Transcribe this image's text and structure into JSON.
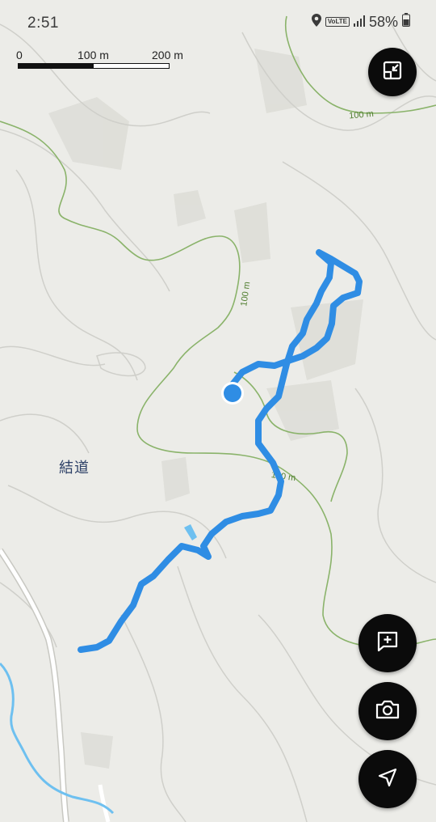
{
  "status_bar": {
    "time": "2:51",
    "network_badge": "VoLTE",
    "battery": "58%",
    "icons": [
      "location-pin-icon",
      "signal-icon",
      "battery-icon"
    ]
  },
  "scale": {
    "label_zero": "0",
    "label_mid": "100 m",
    "label_max": "200 m"
  },
  "map": {
    "place_label": "結道",
    "contour_labels": [
      "100 m",
      "100 m",
      "100 m"
    ],
    "colors": {
      "background": "#ecece8",
      "contour": "#8ab36a",
      "track": "#2f8de4",
      "location_dot": "#2f8de4",
      "road": "#ffffff",
      "stream": "#6ec0f0"
    }
  },
  "buttons": {
    "exit_fullscreen": "exit-fullscreen-icon",
    "add_note": "add-note-icon",
    "camera": "camera-icon",
    "navigate": "navigation-arrow-icon"
  }
}
